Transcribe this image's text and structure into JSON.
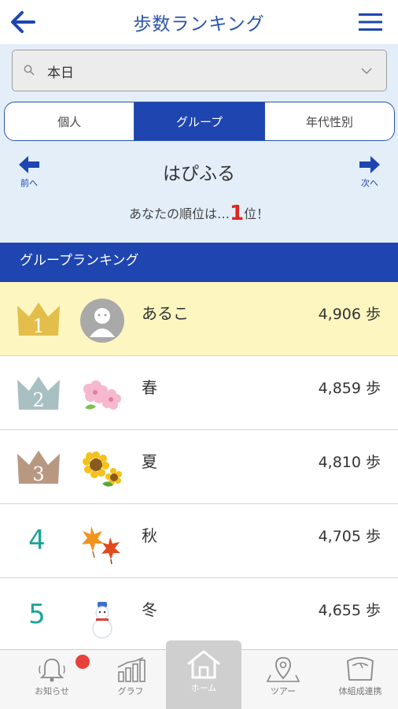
{
  "header": {
    "title": "歩数ランキング",
    "back_icon": "arrow-left-icon",
    "menu_icon": "hamburger-menu-icon"
  },
  "filter": {
    "value": "本日",
    "search_icon": "search-icon",
    "dropdown_icon": "chevron-down-icon"
  },
  "segments": [
    {
      "label": "個人",
      "active": false
    },
    {
      "label": "グループ",
      "active": true
    },
    {
      "label": "年代性別",
      "active": false
    }
  ],
  "nav": {
    "prev_label": "前へ",
    "next_label": "次へ"
  },
  "group_name": "はぴふる",
  "rank_message": {
    "prefix": "あなたの順位は…",
    "rank": "1",
    "suffix": "位！"
  },
  "section_title": "グループランキング",
  "ranking": [
    {
      "rank": "1",
      "name": "あるこ",
      "steps": "4,906 歩",
      "avatar": "default-person-avatar",
      "badge": "gold-crown-icon"
    },
    {
      "rank": "2",
      "name": "春",
      "steps": "4,859 歩",
      "avatar": "cherry-blossom-icon",
      "badge": "silver-crown-icon"
    },
    {
      "rank": "3",
      "name": "夏",
      "steps": "4,810 歩",
      "avatar": "sunflower-icon",
      "badge": "bronze-crown-icon"
    },
    {
      "rank": "4",
      "name": "秋",
      "steps": "4,705 歩",
      "avatar": "autumn-leaves-icon"
    },
    {
      "rank": "5",
      "name": "冬",
      "steps": "4,655 歩",
      "avatar": "snowman-icon"
    }
  ],
  "bottom_nav": [
    {
      "label": "お知らせ",
      "icon": "bell-icon",
      "has_badge": true
    },
    {
      "label": "グラフ",
      "icon": "bar-chart-icon"
    },
    {
      "label": "ホーム",
      "icon": "home-icon",
      "active": true
    },
    {
      "label": "ツアー",
      "icon": "map-pin-icon"
    },
    {
      "label": "体組成連携",
      "icon": "scale-icon"
    }
  ],
  "colors": {
    "brand_blue": "#1e45b0",
    "title_blue": "#2a55a8",
    "panel_bg": "#e3eef9",
    "highlight_row": "#fdf6c0",
    "rank_red": "#e0261f",
    "rank_teal": "#1aa596"
  }
}
